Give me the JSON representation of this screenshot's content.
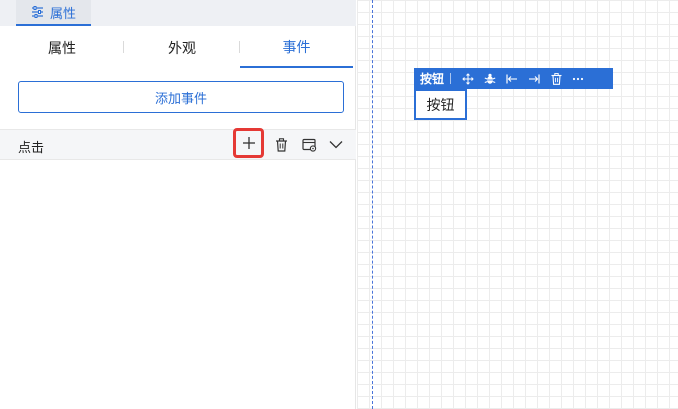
{
  "top_tab": {
    "label": "属性",
    "icon": "sliders-icon"
  },
  "subtabs": [
    {
      "label": "属性",
      "active": false
    },
    {
      "label": "外观",
      "active": false
    },
    {
      "label": "事件",
      "active": true
    }
  ],
  "add_event_label": "添加事件",
  "event": {
    "label": "点击",
    "actions": [
      "plus-icon",
      "trash-icon",
      "window-settings-icon",
      "chevron-down-icon"
    ]
  },
  "component_toolbar": {
    "title": "按钮",
    "actions": [
      "move-icon",
      "bug-icon",
      "align-left-icon",
      "align-right-icon",
      "trash-icon",
      "more-icon"
    ]
  },
  "component": {
    "label": "按钮"
  },
  "colors": {
    "accent": "#2b6fd6",
    "highlight": "#e53935"
  }
}
